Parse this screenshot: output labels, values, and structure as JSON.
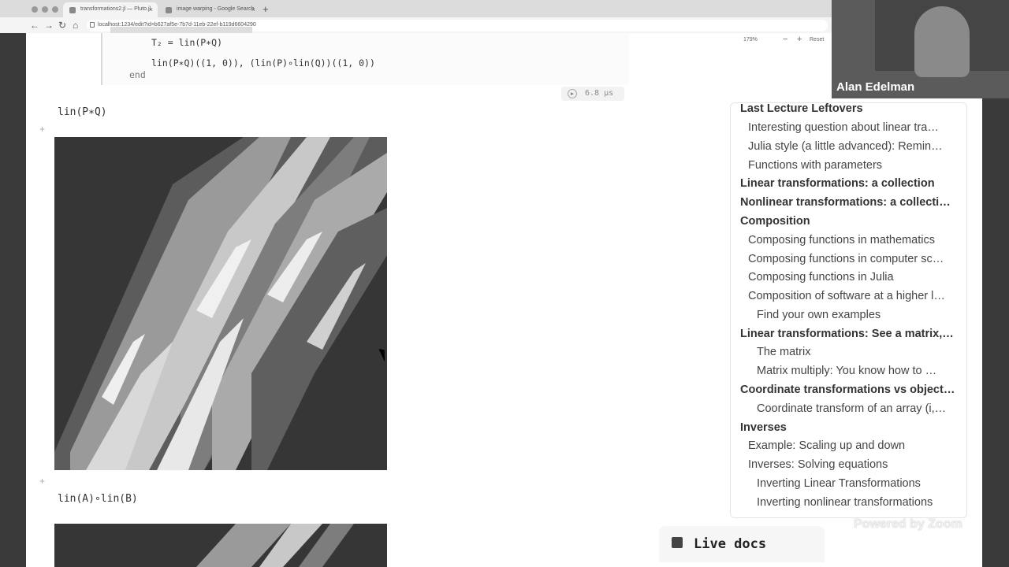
{
  "browser": {
    "tabs": [
      {
        "label": "transformations2.jl — Pluto.jl",
        "close": "×"
      },
      {
        "label": "image warping - Google Search",
        "close": "×"
      }
    ],
    "new_tab": "+",
    "nav": {
      "back": "←",
      "forward": "→",
      "reload": "↻",
      "home": "⌂"
    },
    "url": "localhost:1234/edit?id=b627af5e-7b7d-11eb-22ef-b119d6604290"
  },
  "notebook": {
    "code_lines": [
      "T₂ = lin(P∗Q)",
      "lin(P∗Q)((1, 0)), (lin(P)∘lin(Q))((1, 0))",
      "end"
    ],
    "timing": "6.8 μs",
    "outputs": [
      {
        "label": "lin(P∗Q)"
      },
      {
        "label": "lin(A)∘lin(B)"
      }
    ],
    "add_cell": "+"
  },
  "toc": {
    "items": [
      {
        "level": "h1",
        "text": "Last Lecture Leftovers"
      },
      {
        "level": "h2",
        "text": "Interesting question about linear tra…"
      },
      {
        "level": "h2",
        "text": "Julia style (a little advanced): Remin…"
      },
      {
        "level": "h2",
        "text": "Functions with parameters"
      },
      {
        "level": "h1",
        "text": "Linear transformations: a collection"
      },
      {
        "level": "h1",
        "text": "Nonlinear transformations: a collecti…"
      },
      {
        "level": "h1",
        "text": "Composition"
      },
      {
        "level": "h2",
        "text": "Composing functions in mathematics"
      },
      {
        "level": "h2",
        "text": "Composing functions in computer sc…"
      },
      {
        "level": "h2",
        "text": "Composing functions in Julia"
      },
      {
        "level": "h2",
        "text": "Composition of software at a higher l…"
      },
      {
        "level": "h3",
        "text": "Find your own examples"
      },
      {
        "level": "h1",
        "text": "Linear transformations: See a matrix,…"
      },
      {
        "level": "h3",
        "text": "The matrix"
      },
      {
        "level": "h3",
        "text": "Matrix multiply: You know how to …"
      },
      {
        "level": "h1",
        "text": "Coordinate transformations vs object…"
      },
      {
        "level": "h3",
        "text": "Coordinate transform of an array (i,…"
      },
      {
        "level": "h1",
        "text": "Inverses"
      },
      {
        "level": "h2",
        "text": "Example: Scaling up and down"
      },
      {
        "level": "h2",
        "text": "Inverses: Solving equations"
      },
      {
        "level": "h3",
        "text": "Inverting Linear Transformations"
      },
      {
        "level": "h3",
        "text": "Inverting nonlinear transformations"
      }
    ]
  },
  "video": {
    "name": "Alan Edelman"
  },
  "zoom_overlay": {
    "percent": "179%",
    "minus": "−",
    "plus": "+",
    "reset": "Reset",
    "watermark": "Powered by Zoom"
  },
  "live_docs": {
    "label": "Live docs"
  }
}
